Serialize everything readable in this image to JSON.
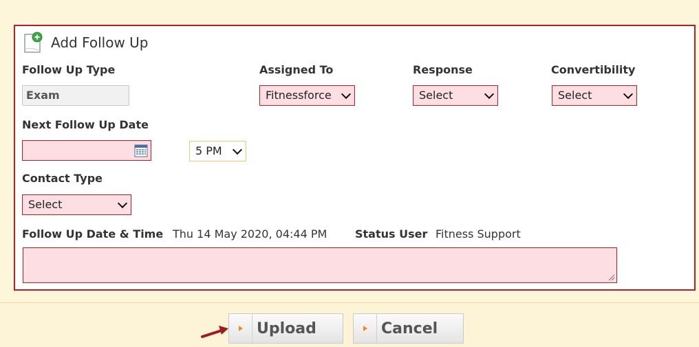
{
  "form": {
    "title": "Add Follow Up",
    "follow_up_type_label": "Follow Up Type",
    "follow_up_type_value": "Exam",
    "assigned_to_label": "Assigned To",
    "assigned_to_value": "Fitnessforce",
    "response_label": "Response",
    "response_value": "Select",
    "convertibility_label": "Convertibility",
    "convertibility_value": "Select",
    "next_follow_up_date_label": "Next Follow Up Date",
    "next_follow_up_date_value": "",
    "time_value": "5 PM",
    "contact_type_label": "Contact Type",
    "contact_type_value": "Select",
    "follow_up_datetime_label": "Follow Up Date & Time",
    "follow_up_datetime_value": "Thu 14 May 2020, 04:44 PM",
    "status_user_label": "Status User",
    "status_user_value": "Fitness Support",
    "notes_value": ""
  },
  "buttons": {
    "upload_label": "Upload",
    "cancel_label": "Cancel"
  },
  "icons": {
    "title_icon": "add-document-icon",
    "date_picker_icon": "calendar-icon",
    "dropdown_icon": "chevron-down-icon",
    "button_icon": "triangle-right-icon",
    "annotation_arrow": "red-arrow-icon"
  },
  "colors": {
    "required_border": "#b52025",
    "required_fill": "#fddfe3",
    "panel_background": "#fef6da",
    "button_triangle": "#f08a1c"
  }
}
